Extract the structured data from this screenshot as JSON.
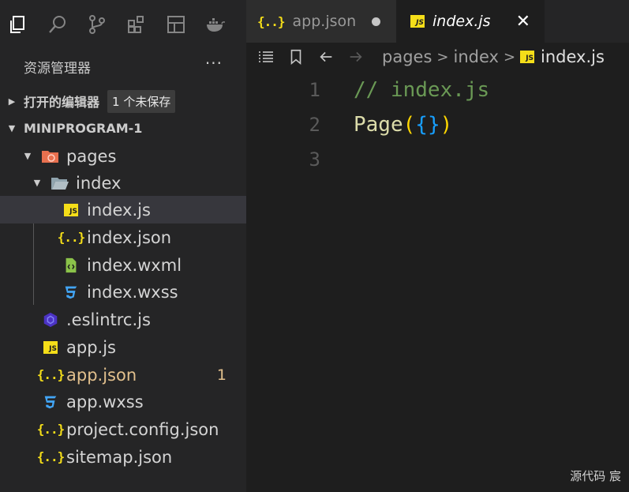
{
  "activity_bar": [
    {
      "name": "explorer-icon"
    },
    {
      "name": "search-icon"
    },
    {
      "name": "source-control-icon"
    },
    {
      "name": "extensions-icon"
    },
    {
      "name": "remote-explorer-icon"
    },
    {
      "name": "docker-icon"
    }
  ],
  "explorer": {
    "title": "资源管理器",
    "more": "···",
    "open_editors_label": "打开的编辑器",
    "unsaved_badge": "1 个未保存",
    "project_label": "MINIPROGRAM-1"
  },
  "tree": {
    "pages": "pages",
    "index": "index",
    "index_js": "index.js",
    "index_json": "index.json",
    "index_wxml": "index.wxml",
    "index_wxss": "index.wxss",
    "eslintrc": ".eslintrc.js",
    "app_js": "app.js",
    "app_json": "app.json",
    "app_json_problems": "1",
    "app_wxss": "app.wxss",
    "project_config": "project.config.json",
    "sitemap": "sitemap.json"
  },
  "tabs": {
    "tab1": "app.json",
    "tab2": "index.js",
    "close": "✕"
  },
  "breadcrumbs": {
    "seg1": "pages",
    "seg2": "index",
    "sep": ">",
    "current": "index.js"
  },
  "code": {
    "line1_no": "1",
    "line2_no": "2",
    "line3_no": "3",
    "line1": "// index.js",
    "line2_fn": "Page",
    "line2_open_paren": "(",
    "line2_open_brace": "{",
    "line2_close_brace": "}",
    "line2_close_paren": ")"
  },
  "watermark": "源代码  宸",
  "colors": {
    "js_badge": "#f5de19",
    "folder_pages": "#e8704f",
    "wxml_green": "#8bc34a",
    "css_blue": "#42a5f5",
    "eslint": "#4b32c3",
    "modified": "#e2c08d"
  }
}
